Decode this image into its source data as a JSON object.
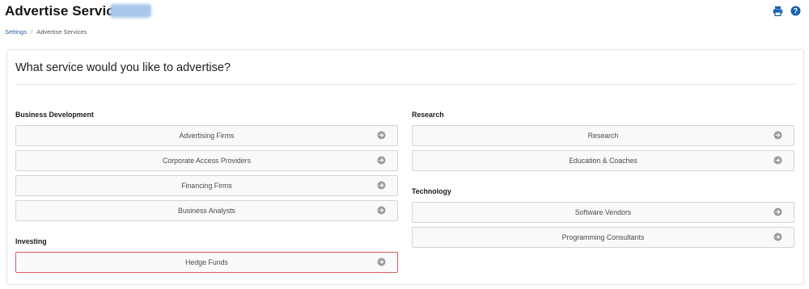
{
  "header": {
    "title": "Advertise Services",
    "icons": [
      "printer-icon",
      "help-icon"
    ]
  },
  "breadcrumb": {
    "items": [
      "Settings",
      "Advertise Services"
    ],
    "separator": "/"
  },
  "main": {
    "question": "What service would you like to advertise?",
    "sections": {
      "business_development": {
        "heading": "Business Development",
        "items": [
          "Advertising Firms",
          "Corporate Access Providers",
          "Financing Firms",
          "Business Analysts"
        ]
      },
      "investing": {
        "heading": "Investing",
        "items": [
          "Hedge Funds"
        ],
        "selected": "Hedge Funds"
      },
      "research": {
        "heading": "Research",
        "items": [
          "Research",
          "Education & Coaches"
        ]
      },
      "technology": {
        "heading": "Technology",
        "items": [
          "Software Vendors",
          "Programming Consultants"
        ]
      }
    }
  },
  "colors": {
    "link": "#2a62a7",
    "icon_blue": "#1c5fae",
    "selected_border": "#d9575c",
    "arrow_grey": "#9a9a9a"
  }
}
